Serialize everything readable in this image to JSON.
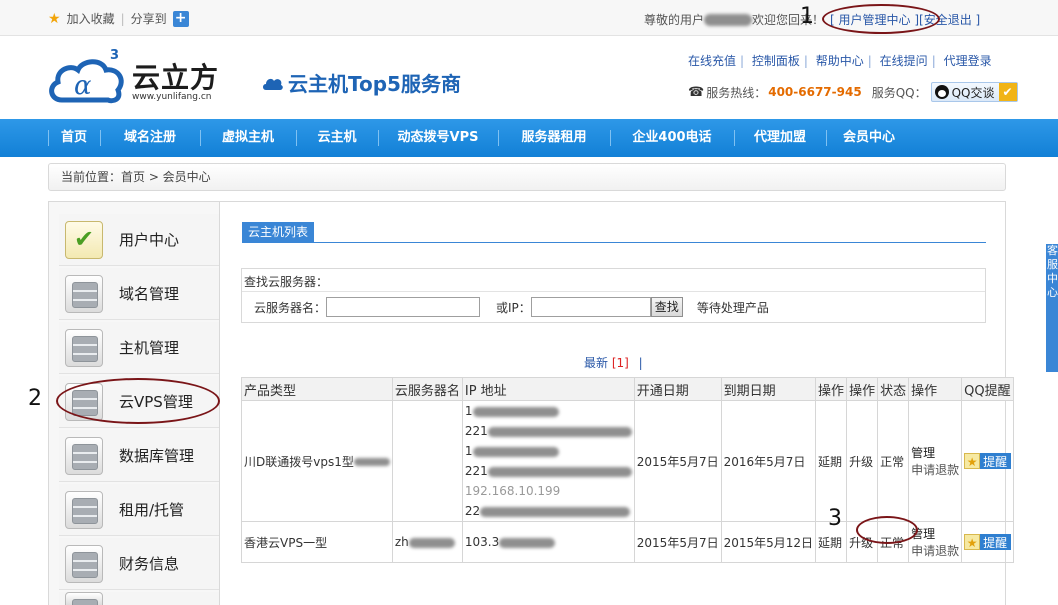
{
  "topbar": {
    "bookmark": "加入收藏",
    "share": "分享到",
    "greeting_prefix": "尊敬的用户",
    "greeting_suffix": "欢迎您回来！",
    "user_center": "[ 用户管理中心 ]",
    "logout": "[安全退出 ]"
  },
  "header": {
    "logo_text": "云立方",
    "logo_sup": "3",
    "logo_url": "www.yunlifang.cn",
    "slogan": "云主机Top5服务商",
    "links": [
      "在线充值",
      "控制面板",
      "帮助中心",
      "在线提问",
      "代理登录"
    ],
    "hotline_label": "服务热线：",
    "hotline_number": "400-6677-945",
    "qq_label": "服务QQ：",
    "qq_button": "QQ交谈"
  },
  "nav": {
    "items": [
      "首页",
      "域名注册",
      "虚拟主机",
      "云主机",
      "动态拨号VPS",
      "服务器租用",
      "企业400电话",
      "代理加盟",
      "会员中心"
    ]
  },
  "breadcrumb": "当前位置：首页 > 会员中心",
  "sidebar": {
    "items": [
      {
        "label": "用户中心",
        "icon": "check-icon"
      },
      {
        "label": "域名管理",
        "icon": "server-icon"
      },
      {
        "label": "主机管理",
        "icon": "server-icon"
      },
      {
        "label": "云VPS管理",
        "icon": "server-icon"
      },
      {
        "label": "数据库管理",
        "icon": "server-icon"
      },
      {
        "label": "租用/托管",
        "icon": "server-icon"
      },
      {
        "label": "财务信息",
        "icon": "server-icon"
      }
    ]
  },
  "main": {
    "tab": "云主机列表",
    "search": {
      "title": "查找云服务器：",
      "name_label": "云服务器名：",
      "name_value": "",
      "ip_label": "或IP：",
      "ip_value": "",
      "button": "查找",
      "pending": "等待处理产品"
    },
    "pager": {
      "latest": "最新",
      "current": "[1]",
      "sep": "|"
    },
    "table": {
      "headers": [
        "产品类型",
        "云服务器名",
        "IP 地址",
        "开通日期",
        "到期日期",
        "操作",
        "操作",
        "状态",
        "操作",
        "QQ提醒"
      ],
      "rows": [
        {
          "type": "川D联通拨号vps1型",
          "name": "",
          "ips": [
            "1",
            "221",
            "1",
            "221",
            "192.168.10.199",
            "22"
          ],
          "open": "2015年5月7日",
          "expire": "2016年5月7日",
          "renew": "延期",
          "upgrade": "升级",
          "status": "正常",
          "manage": "管理",
          "refund": "申请退款",
          "remind": "提醒"
        },
        {
          "type": "香港云VPS一型",
          "name": "zh",
          "ips": [
            "103.3"
          ],
          "open": "2015年5月7日",
          "expire": "2015年5月12日",
          "renew": "延期",
          "upgrade": "升级",
          "status": "正常",
          "manage": "管理",
          "refund": "申请退款",
          "remind": "提醒"
        }
      ]
    }
  },
  "annotations": [
    "1",
    "2",
    "3"
  ],
  "float_tab": "客服中心",
  "colors": {
    "nav": "#1a8ae0",
    "accent": "#3a86d6",
    "annotation": "#7a1518",
    "hotline": "#e46b00"
  }
}
